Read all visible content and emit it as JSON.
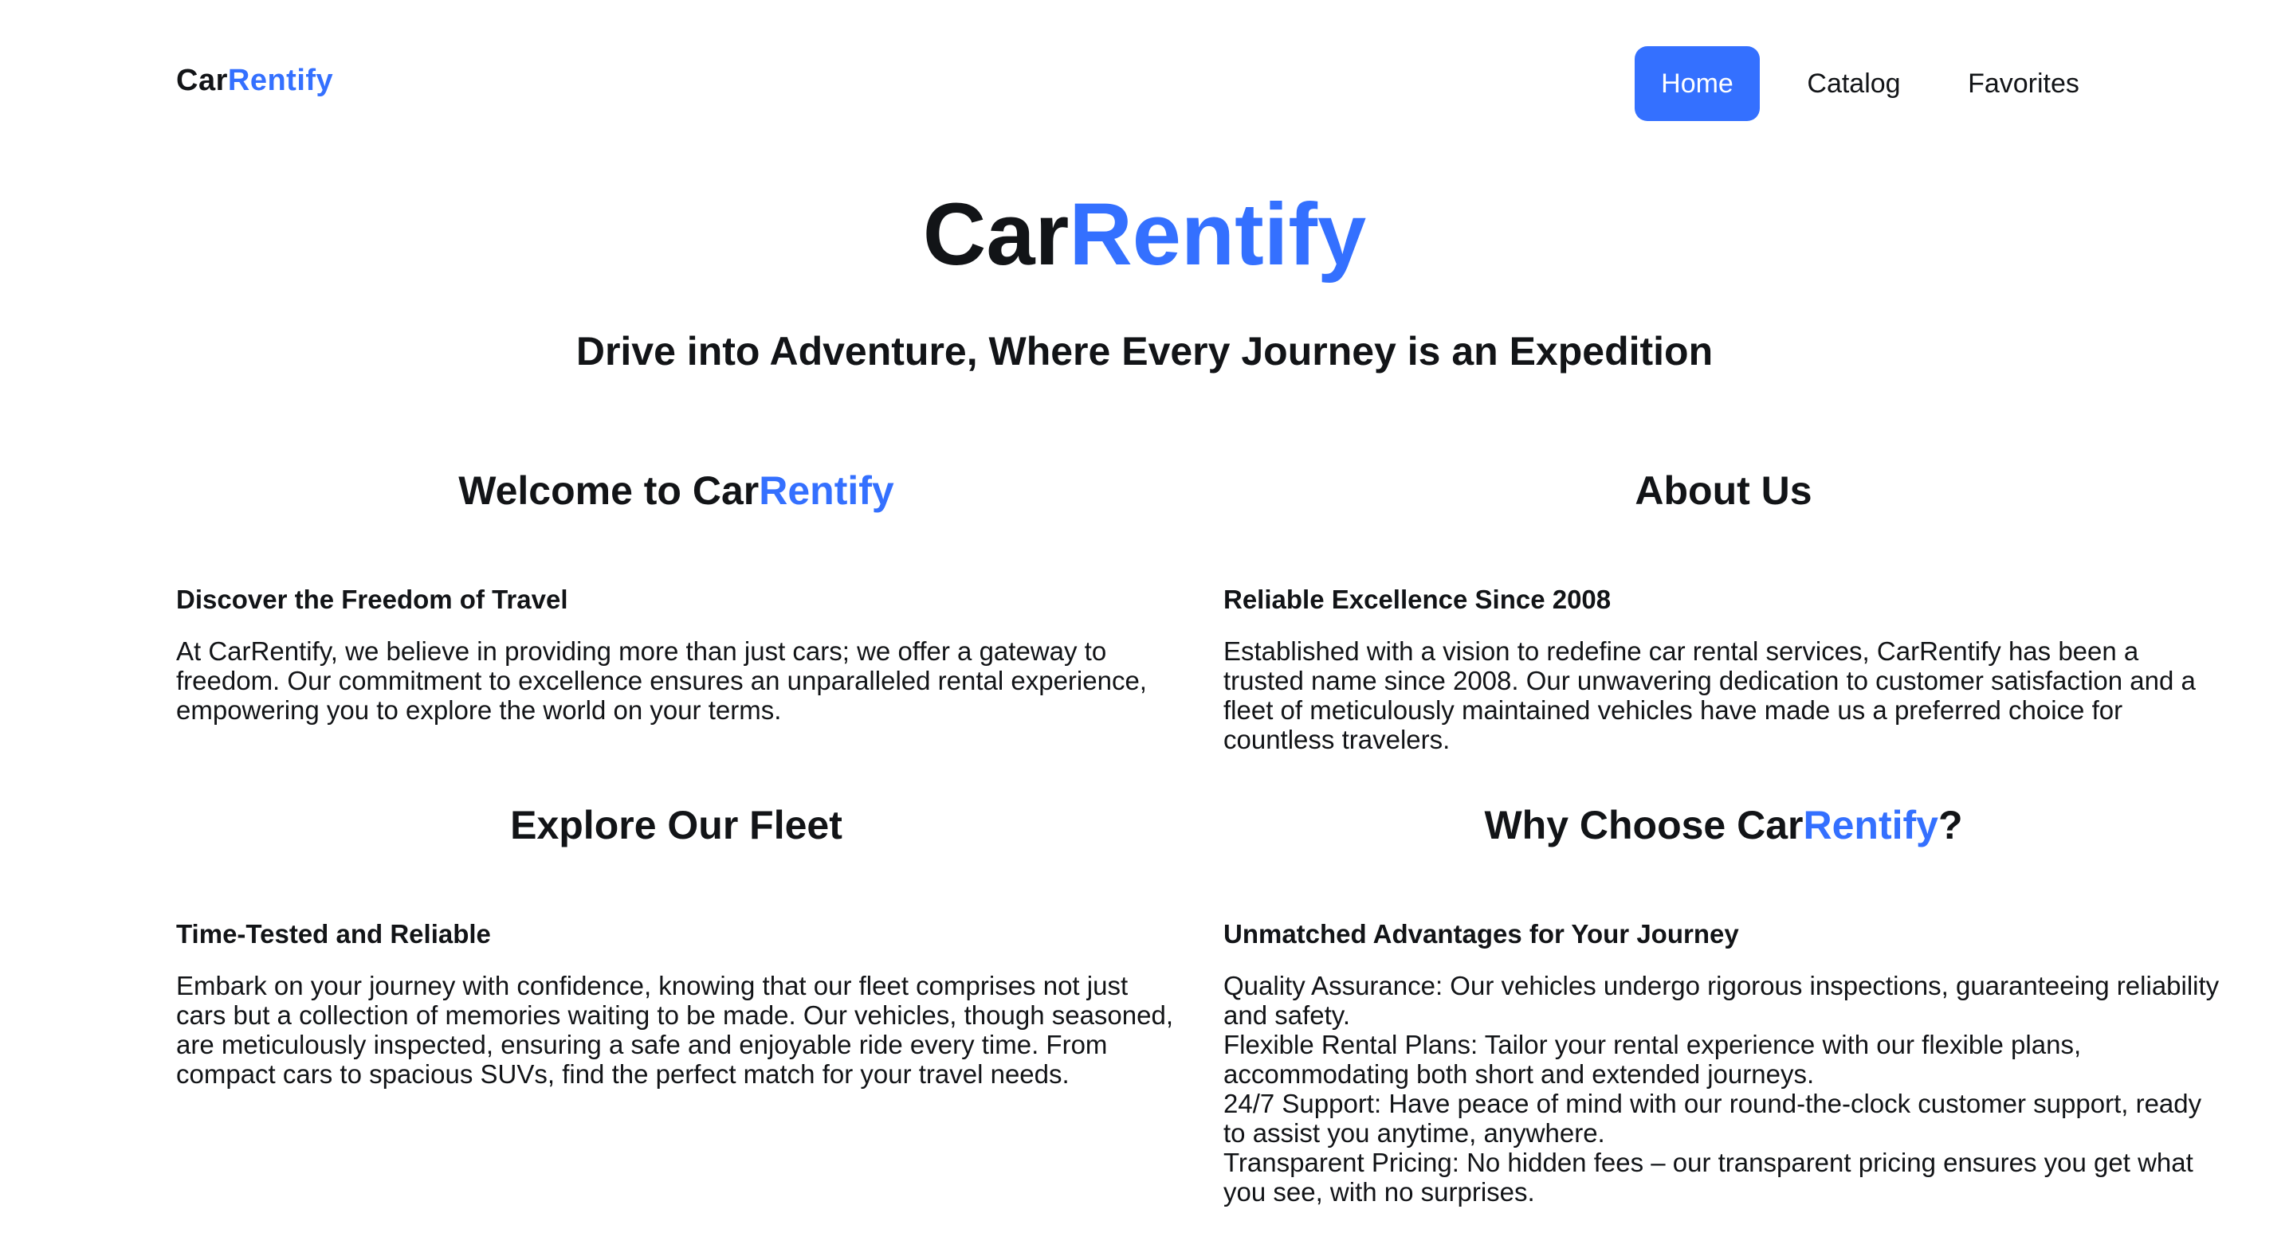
{
  "header": {
    "logo": {
      "part1": "Car",
      "part2": "Rentify"
    },
    "nav": [
      {
        "label": "Home",
        "active": true
      },
      {
        "label": "Catalog",
        "active": false
      },
      {
        "label": "Favorites",
        "active": false
      }
    ]
  },
  "hero": {
    "title_part1": "Car",
    "title_part2": "Rentify",
    "subtitle": "Drive into Adventure, Where Every Journey is an Expedition"
  },
  "sections": {
    "welcome": {
      "title_part1": "Welcome to Car",
      "title_part2": "Rentify",
      "subtitle": "Discover the Freedom of Travel",
      "body": "At CarRentify, we believe in providing more than just cars; we offer a gateway to freedom. Our commitment to excellence ensures an unparalleled rental experience, empowering you to explore the world on your terms."
    },
    "about": {
      "title": "About Us",
      "subtitle": "Reliable Excellence Since 2008",
      "body": "Established with a vision to redefine car rental services, CarRentify has been a trusted name since 2008. Our unwavering dedication to customer satisfaction and a fleet of meticulously maintained vehicles have made us a preferred choice for countless travelers."
    },
    "fleet": {
      "title": "Explore Our Fleet",
      "subtitle": "Time-Tested and Reliable",
      "body": "Embark on your journey with confidence, knowing that our fleet comprises not just cars but a collection of memories waiting to be made. Our vehicles, though seasoned, are meticulously inspected, ensuring a safe and enjoyable ride every time. From compact cars to spacious SUVs, find the perfect match for your travel needs."
    },
    "why": {
      "title_part1": "Why Choose Car",
      "title_part2": "Rentify",
      "title_part3": "?",
      "subtitle": "Unmatched Advantages for Your Journey",
      "items": [
        "Quality Assurance: Our vehicles undergo rigorous inspections, guaranteeing reliability and safety.",
        "Flexible Rental Plans: Tailor your rental experience with our flexible plans, accommodating both short and extended journeys.",
        "24/7 Support: Have peace of mind with our round-the-clock customer support, ready to assist you anytime, anywhere.",
        "Transparent Pricing: No hidden fees – our transparent pricing ensures you get what you see, with no surprises."
      ]
    }
  },
  "colors": {
    "accent": "#3470ff",
    "text": "#121417",
    "background": "#ffffff",
    "nav_active_text": "#ffffff"
  }
}
